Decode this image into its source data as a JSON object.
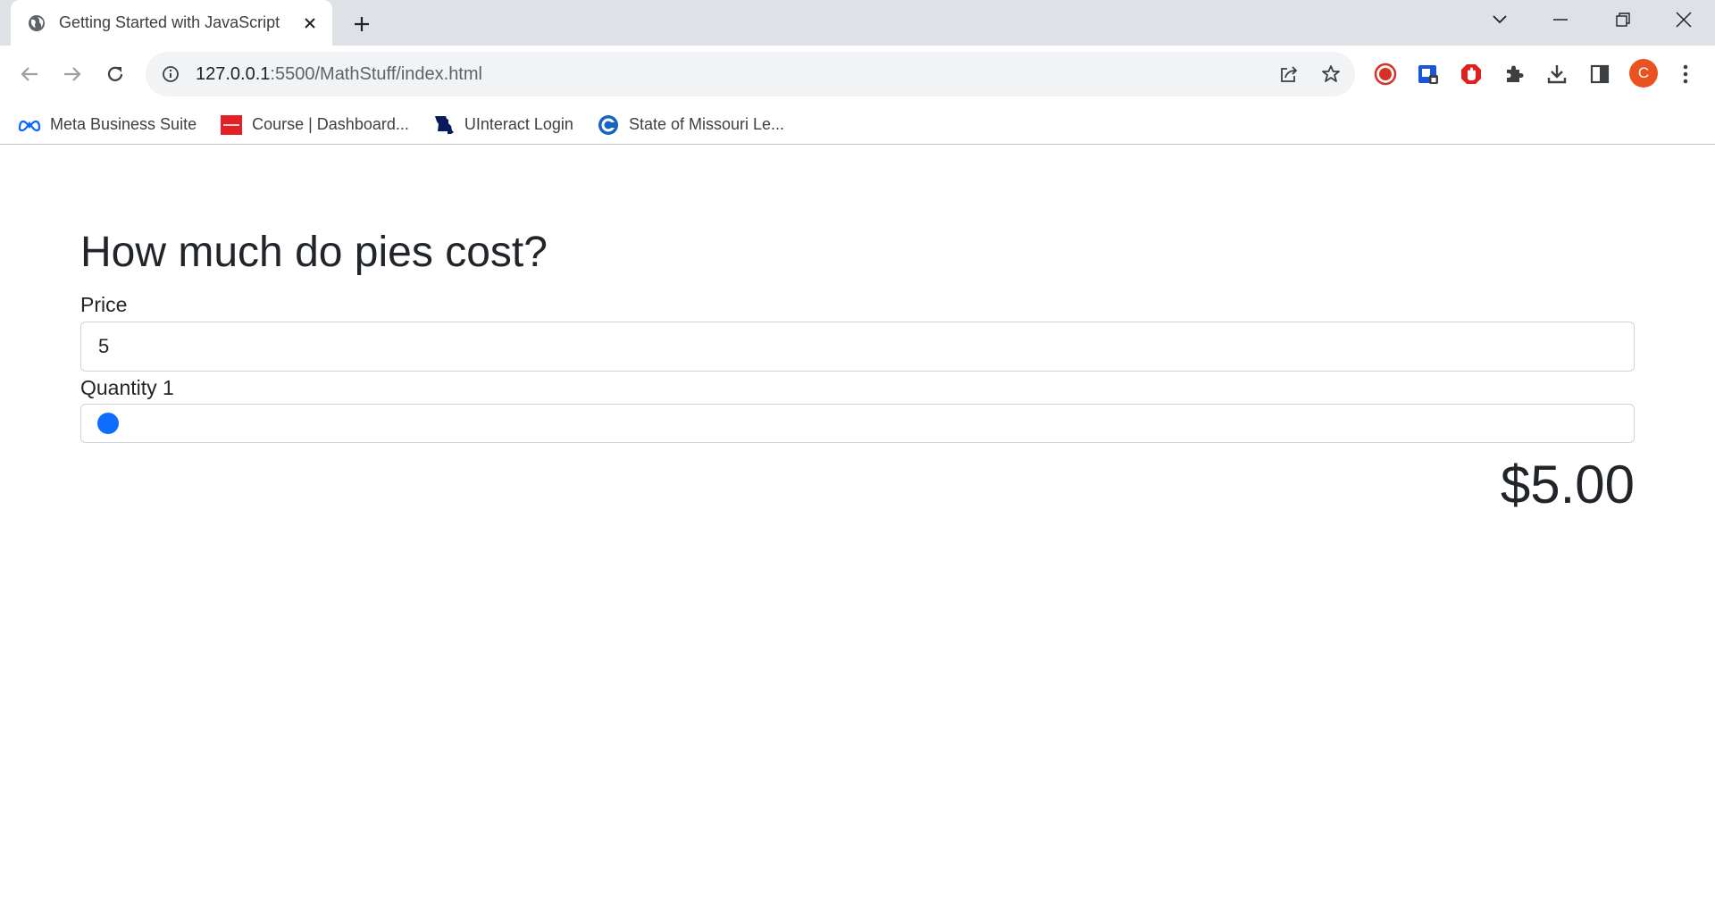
{
  "browser": {
    "tab": {
      "title": "Getting Started with JavaScript"
    },
    "url": {
      "host": "127.0.0.1",
      "path": ":5500/MathStuff/index.html"
    },
    "avatar_letter": "C",
    "avatar_color": "#e8531f",
    "bookmarks": [
      {
        "label": "Meta Business Suite",
        "icon": "meta-icon"
      },
      {
        "label": "Course | Dashboard...",
        "icon": "course-icon"
      },
      {
        "label": "UInteract Login",
        "icon": "missouri-icon"
      },
      {
        "label": "State of Missouri Le...",
        "icon": "c-logo-icon"
      }
    ],
    "extensions": [
      "record-icon",
      "bitwarden-icon",
      "adblock-icon",
      "puzzle-icon",
      "download-icon",
      "side-panel-icon"
    ]
  },
  "page": {
    "title": "How much do pies cost?",
    "price": {
      "label": "Price",
      "value": "5"
    },
    "quantity": {
      "label": "Quantity",
      "value": "1",
      "slider_fraction": 0
    },
    "total": "$5.00",
    "accent_color": "#0d6efd"
  }
}
